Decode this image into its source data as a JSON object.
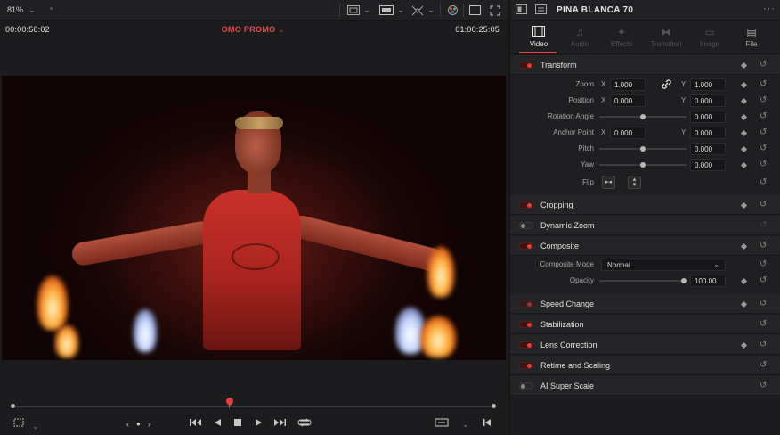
{
  "viewer": {
    "zoom": "81%",
    "timecode_left": "00:00:56:02",
    "timecode_right": "01:00:25:05",
    "timeline_name": "OMO PROMO",
    "transport_icons": [
      "crop-icon",
      "prev-frame-icon",
      "jog-dot-icon",
      "next-frame-icon",
      "skip-start-icon",
      "play-reverse-icon",
      "stop-icon",
      "play-icon",
      "skip-end-icon",
      "loop-icon",
      "match-frame-icon",
      "jump-end-icon"
    ]
  },
  "inspector": {
    "clip_name": "PINA BLANCA 70",
    "tabs": [
      {
        "label": "Video",
        "state": "active"
      },
      {
        "label": "Audio",
        "state": "dim"
      },
      {
        "label": "Effects",
        "state": "dim"
      },
      {
        "label": "Transition",
        "state": "dim"
      },
      {
        "label": "Image",
        "state": "dim"
      },
      {
        "label": "File",
        "state": "normal"
      }
    ],
    "transform": {
      "title": "Transform",
      "zoom_label": "Zoom",
      "zoom_x": "1.000",
      "zoom_y": "1.000",
      "position_label": "Position",
      "position_x": "0.000",
      "position_y": "0.000",
      "rotation_label": "Rotation Angle",
      "rotation": "0.000",
      "anchor_label": "Anchor Point",
      "anchor_x": "0.000",
      "anchor_y": "0.000",
      "pitch_label": "Pitch",
      "pitch": "0.000",
      "yaw_label": "Yaw",
      "yaw": "0.000",
      "flip_label": "Flip",
      "axis_x": "X",
      "axis_y": "Y"
    },
    "cropping": {
      "title": "Cropping"
    },
    "dynamic_zoom": {
      "title": "Dynamic Zoom"
    },
    "composite": {
      "title": "Composite",
      "mode_label": "Composite Mode",
      "mode": "Normal",
      "opacity_label": "Opacity",
      "opacity": "100.00"
    },
    "speed_change": {
      "title": "Speed Change"
    },
    "stabilization": {
      "title": "Stabilization"
    },
    "lens_correction": {
      "title": "Lens Correction"
    },
    "retime_scaling": {
      "title": "Retime and Scaling"
    },
    "ai_super_scale": {
      "title": "AI Super Scale"
    }
  },
  "colors": {
    "accent": "#e0413b",
    "panel": "#1f1f22",
    "section": "#252528"
  }
}
